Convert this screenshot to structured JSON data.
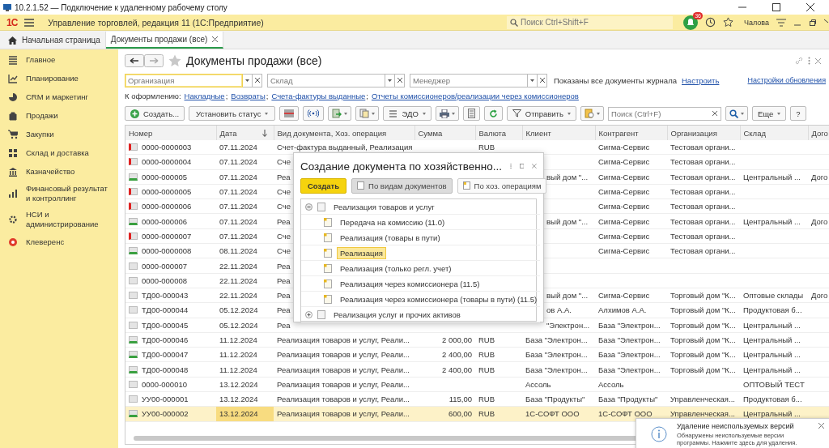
{
  "window": {
    "title": "10.2.1.52 — Подключение к удаленному рабочему столу"
  },
  "app_header": {
    "logo": "1С",
    "title": "Управление торговлей, редакция 11  (1С:Предприятие)",
    "search": {
      "placeholder": "Поиск Ctrl+Shift+F"
    },
    "notifications_count": "36",
    "user": "Чалова"
  },
  "tabs": [
    {
      "label": "Начальная страница",
      "selected": false
    },
    {
      "label": "Документы продажи (все)",
      "selected": true
    }
  ],
  "sidebar": {
    "items": [
      {
        "label": "Главное"
      },
      {
        "label": "Планирование"
      },
      {
        "label": "CRM и маркетинг"
      },
      {
        "label": "Продажи"
      },
      {
        "label": "Закупки"
      },
      {
        "label": "Склад и доставка"
      },
      {
        "label": "Казначейство"
      },
      {
        "label": "Финансовый результат и контроллинг"
      },
      {
        "label": "НСИ и администрирование"
      },
      {
        "label": "Клеверенс"
      }
    ]
  },
  "page": {
    "title": "Документы продажи (все)",
    "filters": [
      {
        "placeholder": "Организация",
        "focused": true
      },
      {
        "placeholder": "Склад",
        "focused": false
      },
      {
        "placeholder": "Менеджер",
        "focused": false
      }
    ],
    "filter_note": "Показаны все документы журнала",
    "filter_link": "Настроить",
    "refresh_settings_link": "Настройки обновления",
    "todo_label": "К оформлению:",
    "todo_links": [
      {
        "label": "Накладные",
        "separator": ";"
      },
      {
        "label": "Возвраты",
        "separator": ";"
      },
      {
        "label": "Счета-фактуры выданные",
        "separator": ";"
      },
      {
        "label": "Отчеты комиссионеров/реализации через комиссионеров"
      }
    ],
    "toolbar": {
      "create": "Создать...",
      "set_status": "Установить статус",
      "edo": "ЭДО",
      "send": "Отправить",
      "search": {
        "placeholder": "Поиск (Ctrl+F)"
      },
      "more": "Еще",
      "help": "?"
    }
  },
  "table": {
    "columns": [
      "Номер",
      "Дата",
      "Вид документа, Хоз. операция",
      "Сумма",
      "Валюта",
      "Клиент",
      "Контрагент",
      "Организация",
      "Склад",
      "Дого"
    ],
    "rows": [
      {
        "number": "0000-0000003",
        "date": "07.11.2024",
        "doc_type": "Счет-фактура выданный, Реализация",
        "currency": "RUB",
        "contractor": "Сигма-Сервис",
        "organization": "Тестовая органи...",
        "posted": false,
        "deletion_mark": true,
        "selected": false
      },
      {
        "number": "0000-0000004",
        "date": "07.11.2024",
        "doc_type": "Сче",
        "contractor": "Сигма-Сервис",
        "organization": "Тестовая органи...",
        "posted": false,
        "deletion_mark": true,
        "selected": false
      },
      {
        "number": "0000-000005",
        "date": "07.11.2024",
        "doc_type": "Реа",
        "client": "вый дом \"...",
        "contractor": "Сигма-Сервис",
        "organization": "Тестовая органи...",
        "warehouse": "Центральный ...",
        "contract": "Дого",
        "posted": true,
        "deletion_mark": false,
        "selected": false
      },
      {
        "number": "0000-0000005",
        "date": "07.11.2024",
        "doc_type": "Сче",
        "contractor": "Сигма-Сервис",
        "organization": "Тестовая органи...",
        "posted": false,
        "deletion_mark": true,
        "selected": false
      },
      {
        "number": "0000-0000006",
        "date": "07.11.2024",
        "doc_type": "Сче",
        "contractor": "Сигма-Сервис",
        "organization": "Тестовая органи...",
        "posted": false,
        "deletion_mark": true,
        "selected": false
      },
      {
        "number": "0000-000006",
        "date": "07.11.2024",
        "doc_type": "Реа",
        "client": "вый дом \"...",
        "contractor": "Сигма-Сервис",
        "organization": "Тестовая органи...",
        "warehouse": "Центральный ...",
        "contract": "Дого",
        "posted": true,
        "deletion_mark": false,
        "selected": false
      },
      {
        "number": "0000-0000007",
        "date": "07.11.2024",
        "doc_type": "Сче",
        "contractor": "Сигма-Сервис",
        "organization": "Тестовая органи...",
        "posted": false,
        "deletion_mark": true,
        "selected": false
      },
      {
        "number": "0000-0000008",
        "date": "08.11.2024",
        "doc_type": "Сче",
        "contractor": "Сигма-Сервис",
        "organization": "Тестовая органи...",
        "posted": true,
        "deletion_mark": false,
        "selected": false
      },
      {
        "number": "0000-000007",
        "date": "22.11.2024",
        "doc_type": "Реа",
        "posted": false,
        "deletion_mark": false,
        "selected": false
      },
      {
        "number": "0000-000008",
        "date": "22.11.2024",
        "doc_type": "Реа",
        "posted": false,
        "deletion_mark": false,
        "selected": false
      },
      {
        "number": "ТД00-000043",
        "date": "22.11.2024",
        "doc_type": "Реа",
        "client": "вый дом \"...",
        "contractor": "Сигма-Сервис",
        "organization": "Торговый дом \"К...",
        "warehouse": "Оптовые склады",
        "contract": "Дого",
        "posted": false,
        "deletion_mark": false,
        "selected": false
      },
      {
        "number": "ТД00-000044",
        "date": "05.12.2024",
        "doc_type": "Реа",
        "client": "ов А.А.",
        "contractor": "Алхимов А.А.",
        "organization": "Торговый дом \"К...",
        "warehouse": "Продуктовая б...",
        "posted": false,
        "deletion_mark": false,
        "selected": false
      },
      {
        "number": "ТД00-000045",
        "date": "05.12.2024",
        "doc_type": "Реа",
        "client": "\"Электрон...",
        "contractor": "База \"Электрон...",
        "organization": "Торговый дом \"К...",
        "warehouse": "Центральный ...",
        "posted": false,
        "deletion_mark": false,
        "selected": false
      },
      {
        "number": "ТД00-000046",
        "date": "11.12.2024",
        "doc_type": "Реализация товаров и услуг, Реали...",
        "sum": "2 000,00",
        "currency": "RUB",
        "client": "База \"Электрон...",
        "contractor": "База \"Электрон...",
        "organization": "Торговый дом \"К...",
        "warehouse": "Центральный ...",
        "posted": true,
        "deletion_mark": false,
        "selected": false
      },
      {
        "number": "ТД00-000047",
        "date": "11.12.2024",
        "doc_type": "Реализация товаров и услуг, Реали...",
        "sum": "2 400,00",
        "currency": "RUB",
        "client": "База \"Электрон...",
        "contractor": "База \"Электрон...",
        "organization": "Торговый дом \"К...",
        "warehouse": "Центральный ...",
        "posted": true,
        "deletion_mark": false,
        "selected": false
      },
      {
        "number": "ТД00-000048",
        "date": "11.12.2024",
        "doc_type": "Реализация товаров и услуг, Реали...",
        "sum": "2 400,00",
        "currency": "RUB",
        "client": "База \"Электрон...",
        "contractor": "База \"Электрон...",
        "organization": "Торговый дом \"К...",
        "warehouse": "Центральный ...",
        "posted": true,
        "deletion_mark": false,
        "selected": false
      },
      {
        "number": "0000-000010",
        "date": "13.12.2024",
        "doc_type": "Реализация товаров и услуг, Реали...",
        "client": "Ассоль",
        "contractor": "Ассоль",
        "warehouse": "ОПТОВЫЙ ТЕСТ",
        "posted": false,
        "deletion_mark": false,
        "selected": false
      },
      {
        "number": "УУ00-000001",
        "date": "13.12.2024",
        "doc_type": "Реализация товаров и услуг, Реали...",
        "sum": "115,00",
        "currency": "RUB",
        "client": "База \"Продукты\"",
        "contractor": "База \"Продукты\"",
        "organization": "Управленческая...",
        "warehouse": "Продуктовая б...",
        "posted": false,
        "deletion_mark": false,
        "selected": false
      },
      {
        "number": "УУ00-000002",
        "date": "13.12.2024",
        "doc_type": "Реализация товаров и услуг, Реали...",
        "sum": "600,00",
        "currency": "RUB",
        "client": "1С-СОФТ ООО",
        "contractor": "1С-СОФТ ООО",
        "organization": "Управленческая...",
        "warehouse": "Центральный ...",
        "posted": true,
        "deletion_mark": false,
        "selected": true
      }
    ]
  },
  "dialog": {
    "title": "Создание документа по хозяйственно...",
    "create_button": "Создать",
    "modes": [
      {
        "label": "По видам документов",
        "selected": true
      },
      {
        "label": "По хоз. операциям",
        "selected": false
      }
    ],
    "tree": [
      {
        "label": "Реализация товаров и услуг",
        "expanded": true,
        "selected": false,
        "children": [
          {
            "label": "Передача на комиссию (11.0)",
            "selected": false
          },
          {
            "label": "Реализация (товары в пути)",
            "selected": false
          },
          {
            "label": "Реализация",
            "selected": true
          },
          {
            "label": "Реализация (только регл. учет)",
            "selected": false
          },
          {
            "label": "Реализация через комиссионера (11.5)",
            "selected": false
          },
          {
            "label": "Реализация через комиссионера (товары в пути) (11.5)",
            "selected": false
          }
        ]
      },
      {
        "label": "Реализация услуг и прочих активов",
        "expanded": false,
        "selected": false
      }
    ]
  },
  "notification": {
    "title": "Удаление неиспользуемых версий",
    "text": "Обнаружены неиспользуемые версии программы. Нажмите здесь для удаления."
  }
}
